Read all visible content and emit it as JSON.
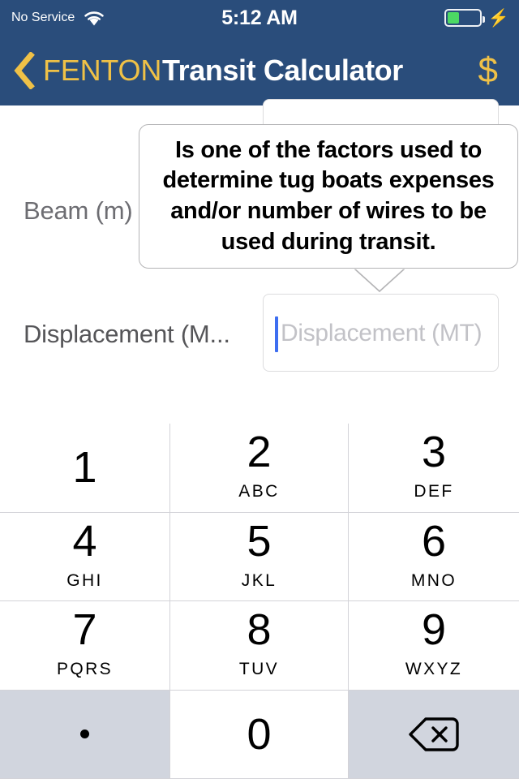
{
  "status_bar": {
    "carrier": "No Service",
    "wifi_icon": "wifi-icon",
    "time": "5:12 AM",
    "battery_icon": "battery-icon",
    "battery_level_pct": 38,
    "battery_color": "#4cd964",
    "charging_icon": "lightning-bolt-icon"
  },
  "nav_bar": {
    "background_color": "#2a4d7b",
    "accent_color": "#efc147",
    "back_icon": "chevron-left-icon",
    "back_label": "FENTON",
    "title": "Transit Calculator",
    "currency_icon": "dollar-sign-icon",
    "currency_label": "$"
  },
  "form": {
    "fields": [
      {
        "label": "Beam (m)",
        "placeholder": "",
        "value": ""
      },
      {
        "label": "Displacement (M...",
        "placeholder": "Displacement (MT)",
        "value": ""
      }
    ]
  },
  "tooltip": {
    "text": "Is one of the factors used to determine tug boats expenses and/or number of wires to be used during transit.",
    "border_color": "#b4b4b6"
  },
  "keypad": {
    "keys": [
      {
        "digit": "1",
        "letters": "",
        "style": "white"
      },
      {
        "digit": "2",
        "letters": "ABC",
        "style": "white"
      },
      {
        "digit": "3",
        "letters": "DEF",
        "style": "white"
      },
      {
        "digit": "4",
        "letters": "GHI",
        "style": "white"
      },
      {
        "digit": "5",
        "letters": "JKL",
        "style": "white"
      },
      {
        "digit": "6",
        "letters": "MNO",
        "style": "white"
      },
      {
        "digit": "7",
        "letters": "PQRS",
        "style": "white"
      },
      {
        "digit": "8",
        "letters": "TUV",
        "style": "white"
      },
      {
        "digit": "9",
        "letters": "WXYZ",
        "style": "white"
      },
      {
        "digit": ".",
        "letters": "",
        "style": "gray"
      },
      {
        "digit": "0",
        "letters": "",
        "style": "white"
      },
      {
        "digit": "",
        "letters": "",
        "style": "gray",
        "icon": "backspace-icon"
      }
    ],
    "gray_key_color": "#d1d5de"
  }
}
